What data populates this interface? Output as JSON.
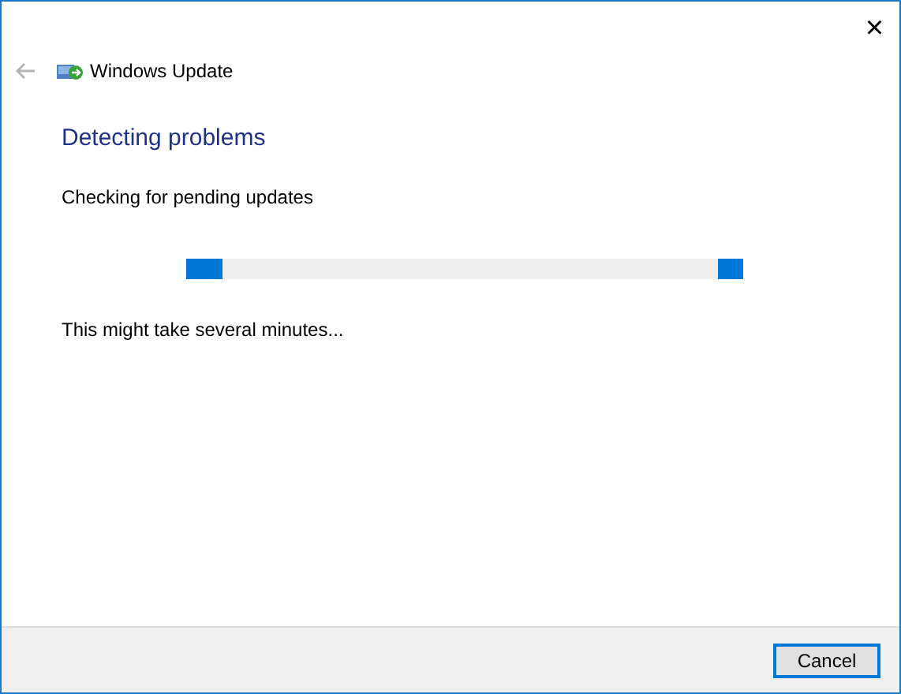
{
  "window": {
    "title": "Windows Update",
    "close": "×"
  },
  "back": {
    "disabled": true
  },
  "heading": "Detecting problems",
  "status": "Checking for pending updates",
  "progress": {
    "indeterminate": true
  },
  "note": "This might take several minutes...",
  "buttons": [
    {
      "label": "Cancel",
      "default": true
    }
  ]
}
